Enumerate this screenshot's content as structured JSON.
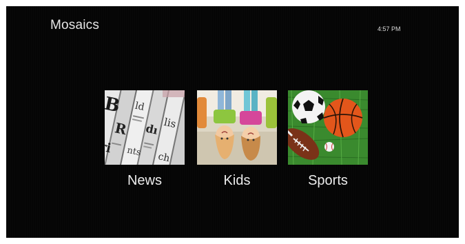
{
  "header": {
    "title": "Mosaics",
    "clock": "4:57 PM"
  },
  "tiles": [
    {
      "label": "News",
      "icon": "newspapers-image"
    },
    {
      "label": "Kids",
      "icon": "kids-image"
    },
    {
      "label": "Sports",
      "icon": "sports-balls-image"
    }
  ],
  "colors": {
    "background": "#050505",
    "text": "#e6e6e6"
  }
}
